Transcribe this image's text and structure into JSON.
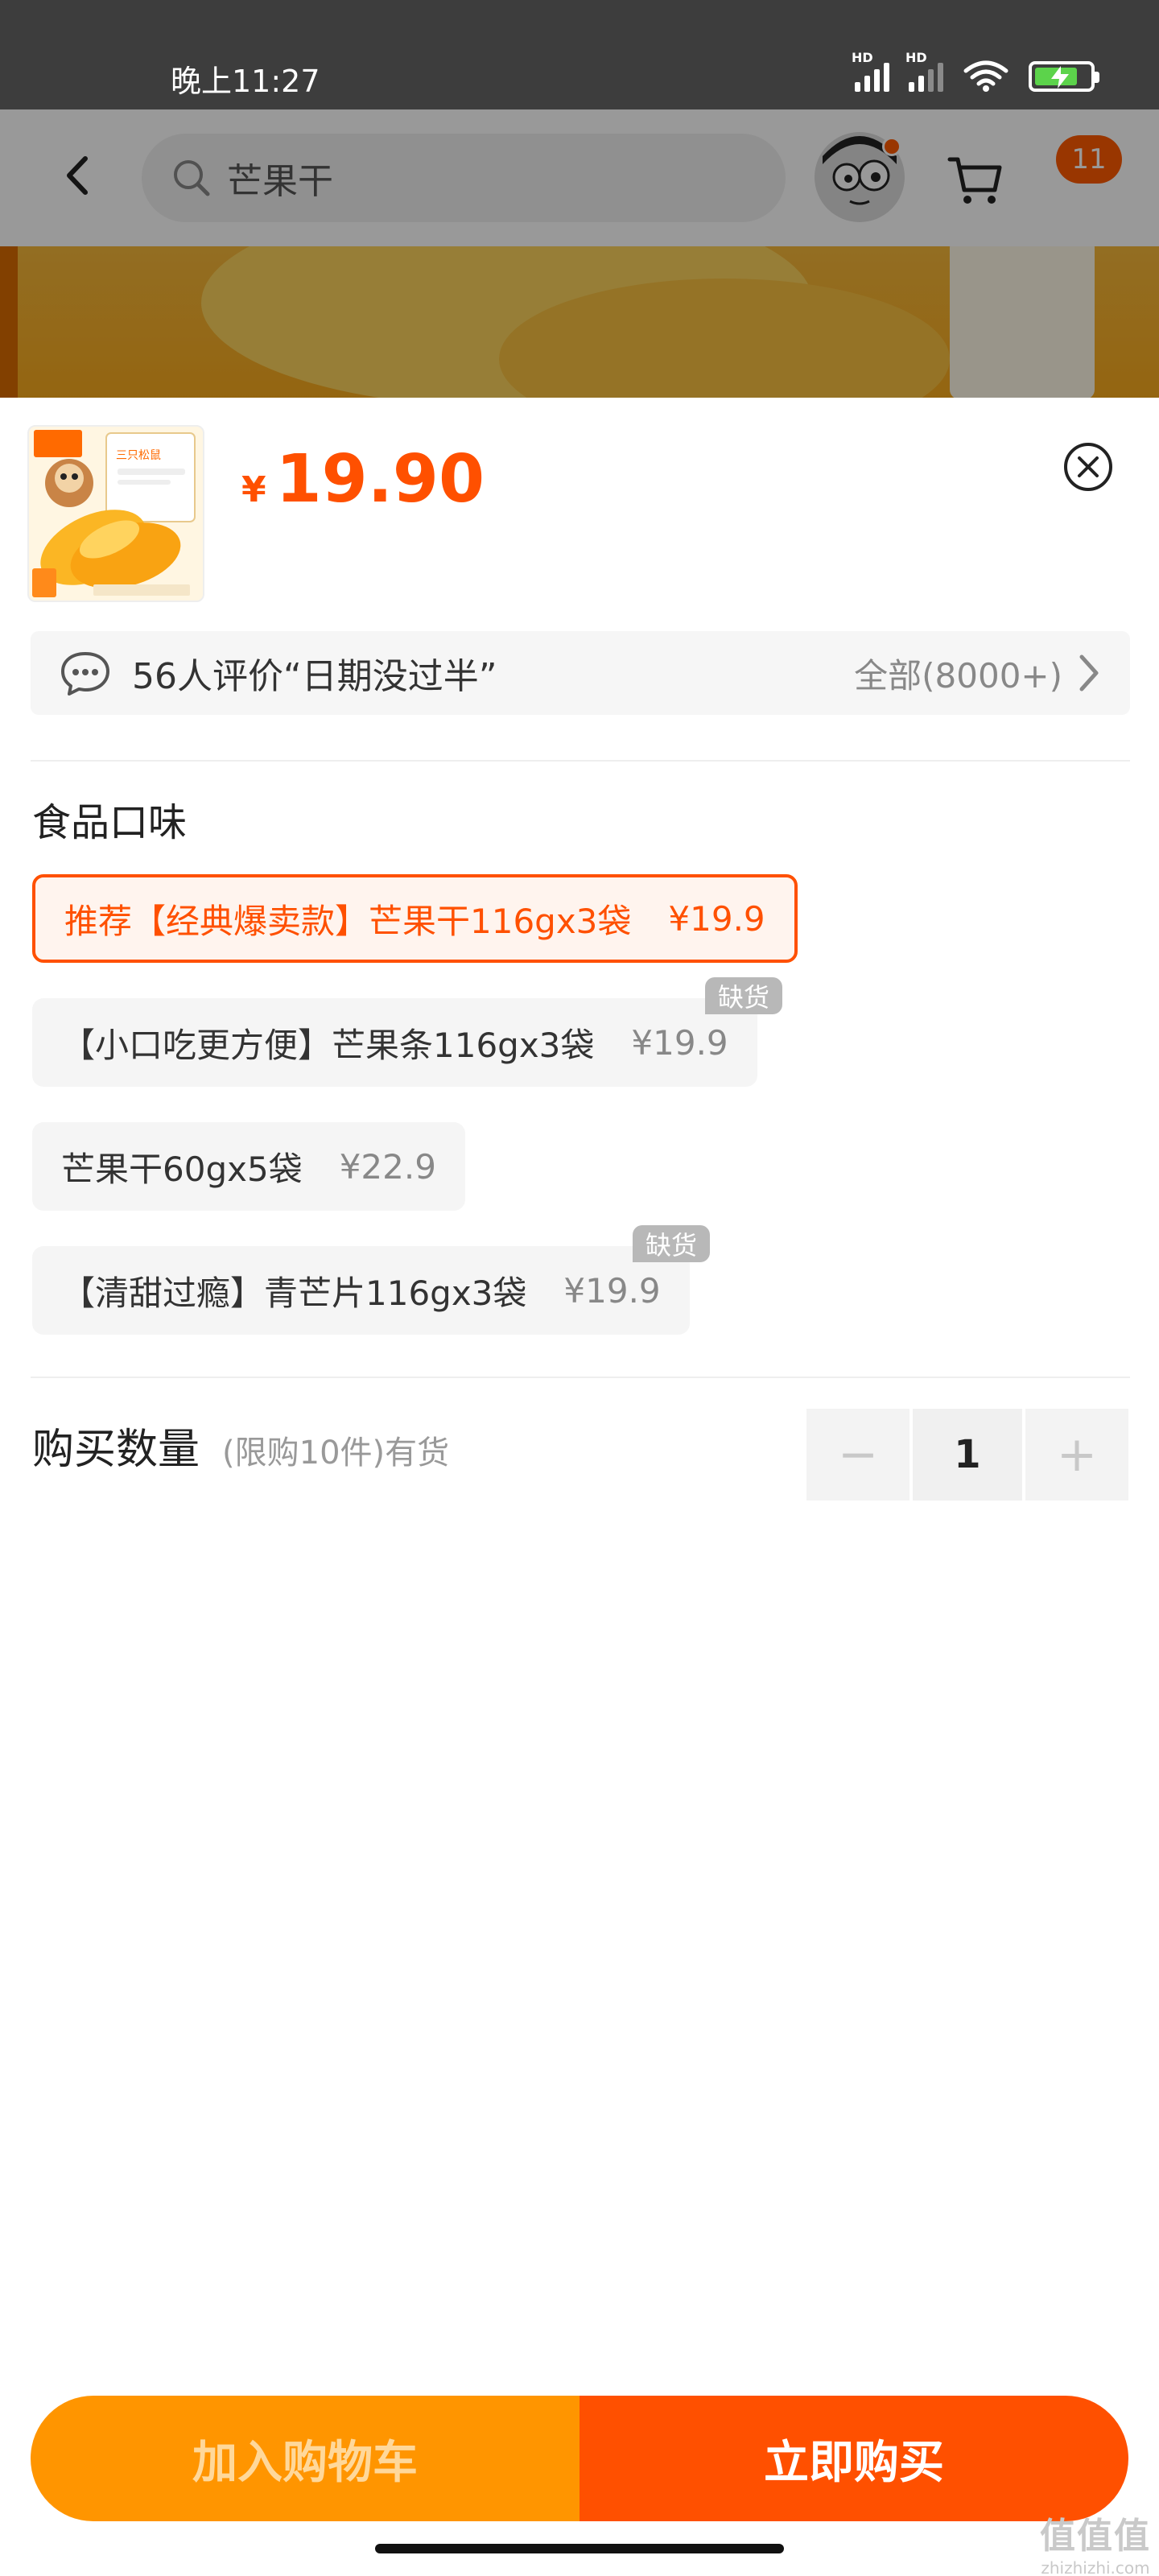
{
  "status_bar": {
    "time": "晚上11:27",
    "signal1_label": "HD",
    "signal2_label": "HD"
  },
  "header": {
    "search_text": "芒果干",
    "cart_badge": "11"
  },
  "sheet": {
    "price_symbol": "¥",
    "price": "19.90",
    "review": {
      "text": "56人评价“日期没过半”",
      "all_label": "全部(8000+)"
    },
    "section_title": "食品口味",
    "options": [
      {
        "label": "推荐【经典爆卖款】芒果干116gx3袋",
        "price": "¥19.9",
        "selected": true,
        "out_of_stock": false
      },
      {
        "label": "【小口吃更方便】芒果条116gx3袋",
        "price": "¥19.9",
        "selected": false,
        "out_of_stock": true
      },
      {
        "label": "芒果干60gx5袋",
        "price": "¥22.9",
        "selected": false,
        "out_of_stock": false
      },
      {
        "label": "【清甜过瘾】青芒片116gx3袋",
        "price": "¥19.9",
        "selected": false,
        "out_of_stock": true
      }
    ],
    "out_of_stock_label": "缺货",
    "quantity": {
      "label": "购买数量",
      "note": "(限购10件)有货",
      "value": "1",
      "minus": "−",
      "plus": "+"
    },
    "add_to_cart": "加入购物车",
    "buy_now": "立即购买"
  },
  "thumbnail": {
    "brand": "三只松鼠",
    "tag1": "全程自己控温",
    "tag2": "果肉厚实 颜色鲜艳"
  },
  "watermark": {
    "line1": "值值值",
    "line2": "zhizhizhi.com"
  },
  "colors": {
    "accent": "#ff5000",
    "cart_button": "#ff9500",
    "status_bar": "#3d3d3d"
  }
}
